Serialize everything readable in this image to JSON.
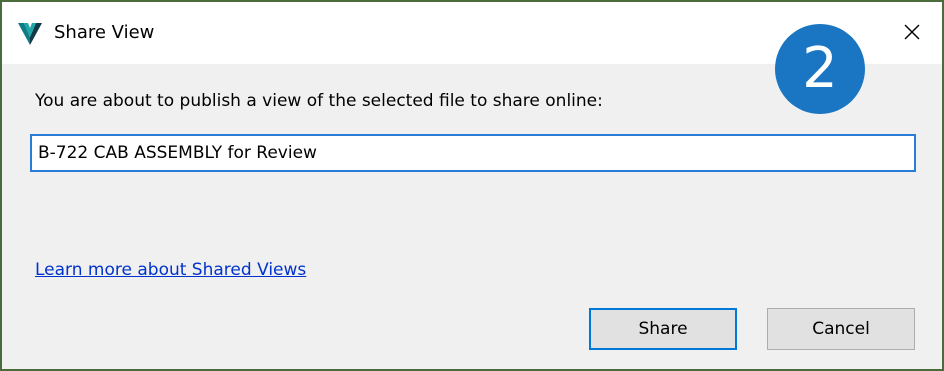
{
  "window": {
    "title": "Share View",
    "app_icon": "autodesk-viewer-v-icon",
    "close_icon": "close-icon"
  },
  "badge": {
    "label": "2",
    "color": "#1a76c2"
  },
  "dialog": {
    "prompt": "You are about to publish a view of the selected file to share online:",
    "name_value": "B-722 CAB ASSEMBLY for Review",
    "learn_more_link": "Learn more about Shared Views"
  },
  "buttons": {
    "share_label": "Share",
    "cancel_label": "Cancel"
  },
  "colors": {
    "frame_border": "#4a6b3c",
    "link": "#0033cc",
    "focus_border": "#0078d7"
  }
}
